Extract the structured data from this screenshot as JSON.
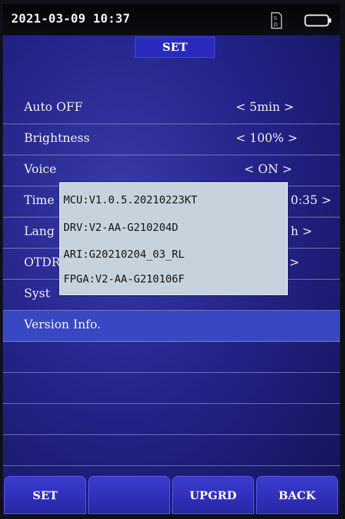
{
  "status_bar": {
    "datetime": "2021-03-09 10:37",
    "sd_icon": "sd-card-icon",
    "battery_icon": "battery-icon"
  },
  "title": "SET",
  "menu": {
    "rows": [
      {
        "label": "Auto OFF",
        "value": "< 5min >"
      },
      {
        "label": "Brightness",
        "value": "< 100% >"
      },
      {
        "label": "Voice",
        "value": "< ON >"
      },
      {
        "label": "Time",
        "value": "0:35 >"
      },
      {
        "label": "Lang",
        "value": "h >"
      },
      {
        "label": "OTDR",
        "value": ">"
      },
      {
        "label": "Syst",
        "value": ""
      },
      {
        "label": "Version Info.",
        "value": ""
      }
    ],
    "selected_index": 7
  },
  "popup": {
    "mcu": "MCU:V1.0.5.20210223KT",
    "drv": "DRV:V2-AA-G210204D",
    "ari": "ARI:G20210204_03_RL",
    "fpga": "FPGA:V2-AA-G210106F"
  },
  "softkeys": [
    "SET",
    "",
    "UPGRD",
    "BACK"
  ],
  "colors": {
    "screen_bg": "#24248a",
    "selected_row": "#3848c2",
    "popup_bg": "#c6d2dc",
    "softkey": "#2f2fbc"
  }
}
